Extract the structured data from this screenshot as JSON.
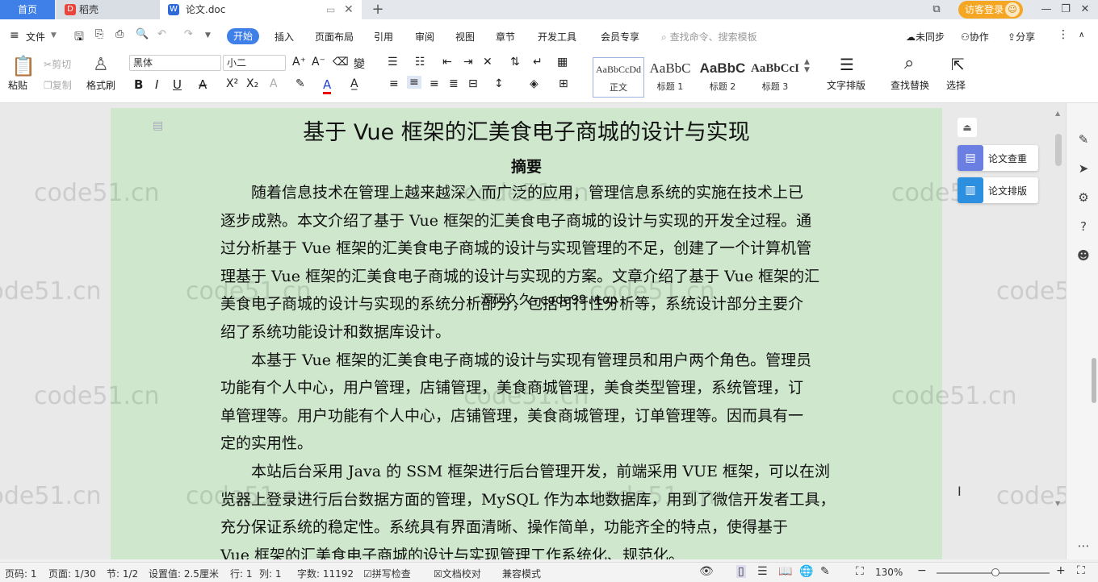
{
  "tabs": {
    "home": "首页",
    "daoke": "稻壳",
    "doc": "论文.doc",
    "login": "访客登录"
  },
  "menu": {
    "file": "文件",
    "items": [
      "开始",
      "插入",
      "页面布局",
      "引用",
      "审阅",
      "视图",
      "章节",
      "开发工具",
      "会员专享"
    ],
    "search": "查找命令、搜索模板",
    "unsynced": "未同步",
    "collab": "协作",
    "share": "分享"
  },
  "ribbon": {
    "paste": "粘贴",
    "cut": "剪切",
    "copy": "复制",
    "format_painter": "格式刷",
    "font": "黑体",
    "size": "小二",
    "styles": [
      {
        "sample": "AaBbCcDd",
        "label": "正文"
      },
      {
        "sample": "AaBbC",
        "label": "标题 1"
      },
      {
        "sample": "AaBbC",
        "label": "标题 2"
      },
      {
        "sample": "AaBbCcI",
        "label": "标题 3"
      }
    ],
    "text_layout": "文字排版",
    "find_replace": "查找替换",
    "select": "选择"
  },
  "document": {
    "title": "基于 Vue 框架的汇美食电子商城的设计与实现",
    "abstract_heading": "摘要",
    "lines": [
      "随着信息技术在管理上越来越深入而广泛的应用，管理信息系统的实施在技术上已",
      "逐步成熟。本文介绍了基于 Vue 框架的汇美食电子商城的设计与实现的开发全过程。通",
      "过分析基于 Vue 框架的汇美食电子商城的设计与实现管理的不足，创建了一个计算机管",
      "理基于 Vue 框架的汇美食电子商城的设计与实现的方案。文章介绍了基于 Vue 框架的汇",
      "美食电子商城的设计与实现的系统分析部分，包括可行性分析等，系统设计部分主要介",
      "绍了系统功能设计和数据库设计。",
      "本基于 Vue 框架的汇美食电子商城的设计与实现有管理员和用户两个角色。管理员",
      "功能有个人中心，用户管理，店铺管理，美食商城管理，美食类型管理，系统管理，订",
      "单管理等。用户功能有个人中心，店铺管理，美食商城管理，订单管理等。因而具有一",
      "定的实用性。",
      "本站后台采用 Java 的 SSM 框架进行后台管理开发，前端采用 VUE 框架，可以在浏",
      "览器上登录进行后台数据方面的管理，MySQL 作为本地数据库，用到了微信开发者工具，",
      "充分保证系统的稳定性。系统具有界面清晰、操作简单，功能齐全的特点，使得基于",
      "Vue 框架的汇美食电子商城的设计与实现管理工作系统化、规范化。"
    ],
    "overlay": "源码久久-code99.top",
    "watermark": "code51.cn"
  },
  "right_panel": {
    "check": "论文查重",
    "layout": "论文排版"
  },
  "status": {
    "page_no": "页码: 1",
    "page": "页面: 1/30",
    "section": "节: 1/2",
    "setting": "设置值: 2.5厘米",
    "row": "行: 1",
    "col": "列: 1",
    "words": "字数: 11192",
    "spell": "拼写检查",
    "proof": "文档校对",
    "compat": "兼容模式",
    "zoom": "130%"
  }
}
